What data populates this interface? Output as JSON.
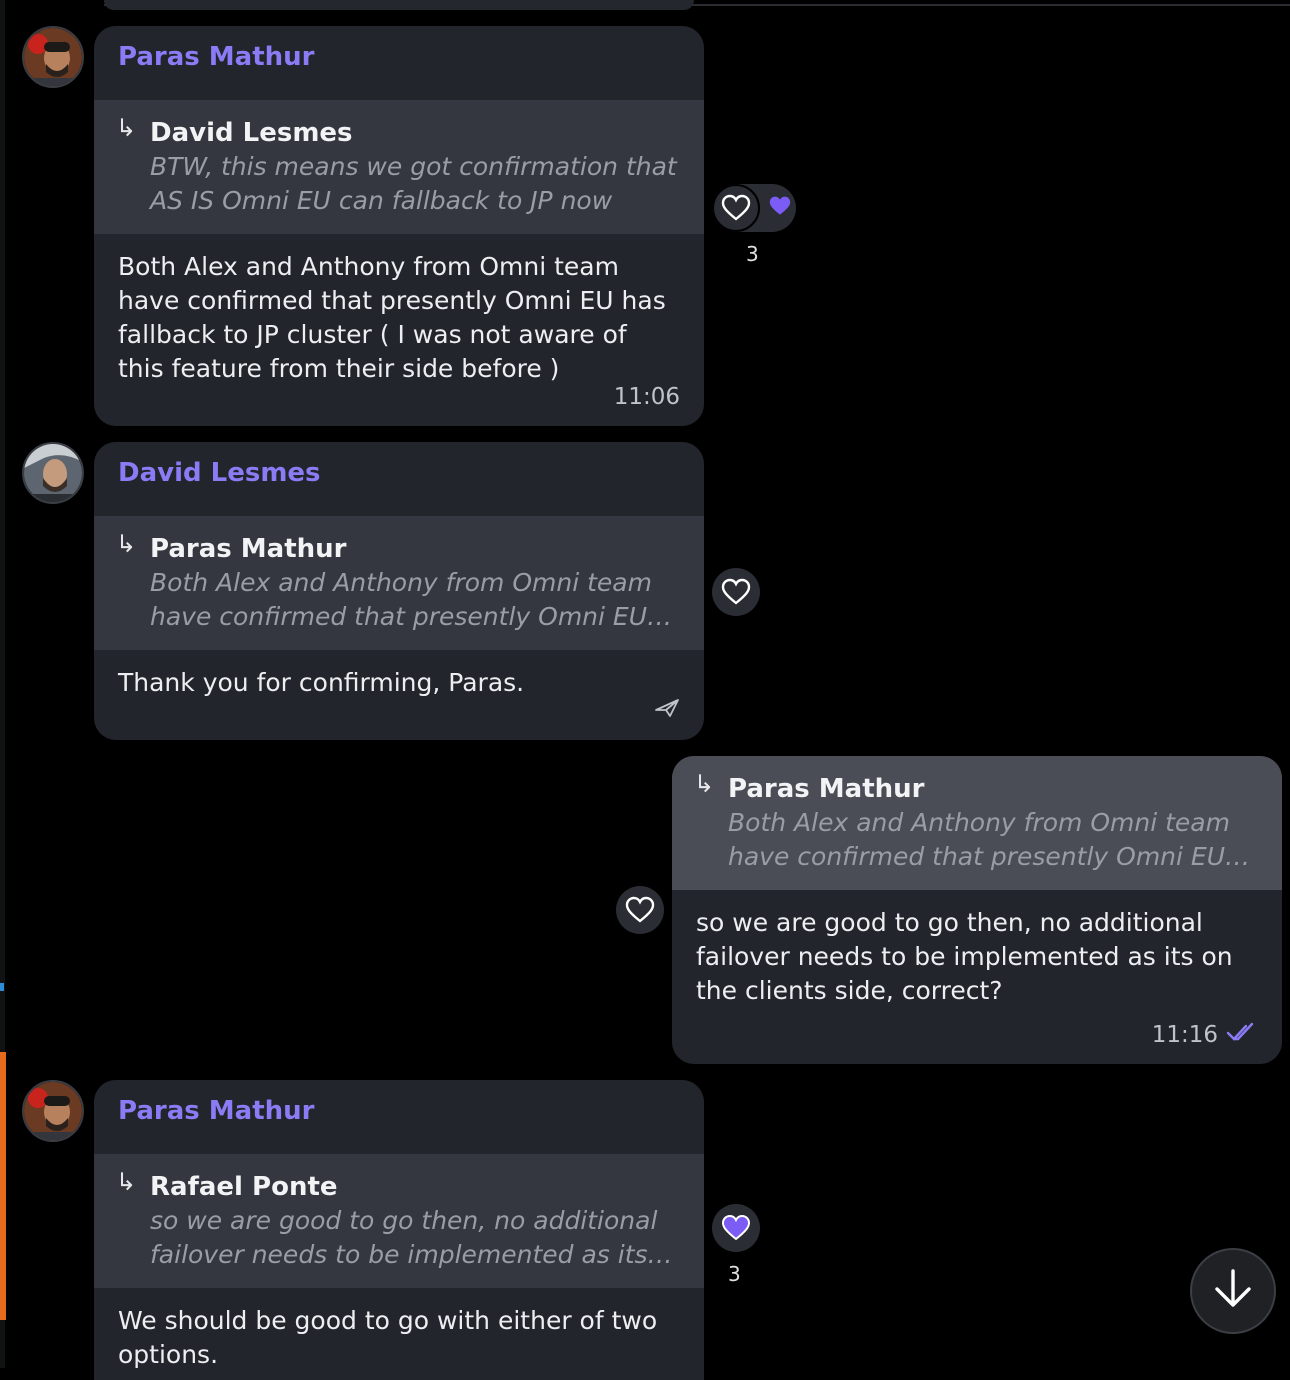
{
  "messages": [
    {
      "sender": "Paras Mathur",
      "reply": {
        "name": "David Lesmes",
        "text": "BTW, this means we got confirmation that\nAS IS Omni EU can fallback to JP now"
      },
      "text": "Both Alex and Anthony from Omni team\nhave confirmed that presently Omni EU has\nfallback to JP cluster ( I was not aware of\nthis feature from their side before )",
      "time": "11:06",
      "reaction_count": "3"
    },
    {
      "sender": "David Lesmes",
      "reply": {
        "name": "Paras Mathur",
        "text": "Both Alex and Anthony from Omni team\nhave confirmed that presently Omni EU…"
      },
      "text": "Thank you for confirming, Paras."
    },
    {
      "reply": {
        "name": "Paras Mathur",
        "text": "Both Alex and Anthony from Omni team\nhave confirmed that presently Omni EU…"
      },
      "text": "so we are good to go then, no additional\nfailover needs to be implemented as its on\nthe clients side, correct?",
      "time": "11:16"
    },
    {
      "sender": "Paras Mathur",
      "reply": {
        "name": "Rafael Ponte",
        "text": "so we are good to go then, no additional\nfailover needs to be implemented as its…"
      },
      "text": "We should be good to go with either of two\noptions.",
      "reaction_count": "3"
    }
  ],
  "colors": {
    "accent": "#8b7cf6",
    "bubble": "#22252b",
    "reply_block": "#34373f",
    "reply_block_out": "#4a4d56",
    "reaction_fill": "#7b5cf5"
  },
  "icons": [
    "reply-arrow-icon",
    "heart-outline-icon",
    "heart-filled-icon",
    "sent-icon",
    "double-check-icon",
    "arrow-down-icon"
  ]
}
